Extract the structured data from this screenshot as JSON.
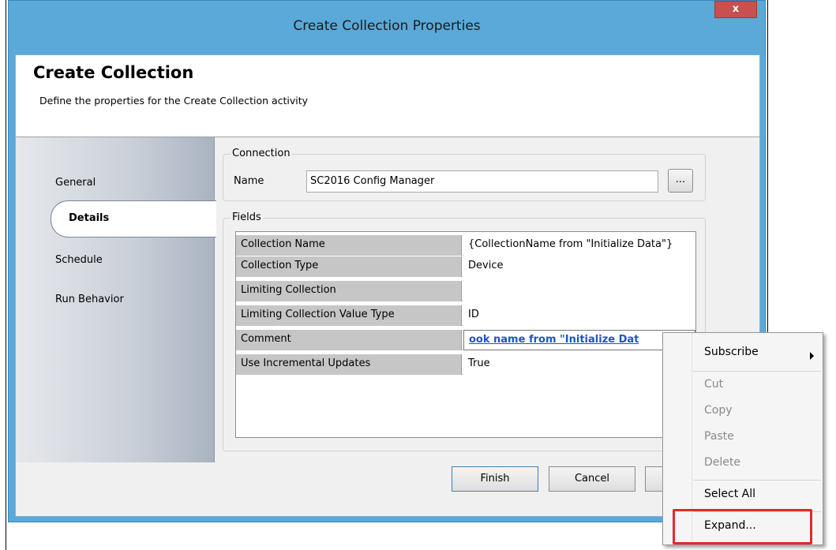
{
  "window": {
    "title": "Create Collection Properties",
    "close_label": "x"
  },
  "header": {
    "title": "Create Collection",
    "subtitle": "Define the properties for the Create Collection activity"
  },
  "nav": {
    "items": [
      {
        "label": "General"
      },
      {
        "label": "Details",
        "selected": true
      },
      {
        "label": "Schedule"
      },
      {
        "label": "Run Behavior"
      }
    ]
  },
  "connection": {
    "group_label": "Connection",
    "name_label": "Name",
    "name_value": "SC2016 Config Manager",
    "browse_label": "..."
  },
  "fields": {
    "group_label": "Fields",
    "rows": [
      {
        "key": "Collection Name",
        "value": "{CollectionName from \"Initialize Data\"}"
      },
      {
        "key": "Collection Type",
        "value": "Device"
      },
      {
        "key": "Limiting Collection",
        "value": ""
      },
      {
        "key": "Limiting Collection Value Type",
        "value": "ID"
      },
      {
        "key": "Comment",
        "value": "ook name from \"Initialize Dat"
      },
      {
        "key": "Use Incremental Updates",
        "value": "True"
      }
    ]
  },
  "buttons": {
    "finish": "Finish",
    "cancel": "Cancel"
  },
  "context_menu": {
    "items": [
      {
        "label": "Subscribe",
        "enabled": true,
        "submenu": true
      },
      {
        "label": "Cut",
        "enabled": false
      },
      {
        "label": "Copy",
        "enabled": false
      },
      {
        "label": "Paste",
        "enabled": false
      },
      {
        "label": "Delete",
        "enabled": false
      },
      {
        "label": "Select All",
        "enabled": true
      },
      {
        "label": "Expand...",
        "enabled": true,
        "highlighted": true
      }
    ]
  },
  "colors": {
    "titlebar": "#5aa9d9",
    "close_button": "#c75050",
    "highlight": "#e22a2a",
    "link_text": "#1a56c9"
  }
}
